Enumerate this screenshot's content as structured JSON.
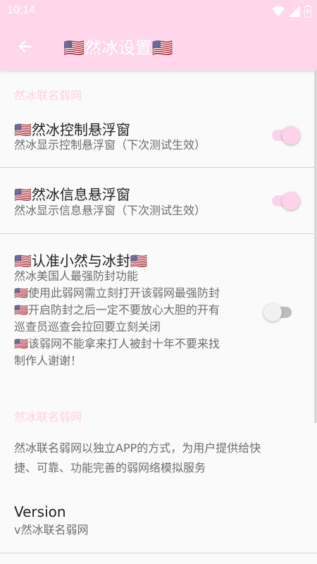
{
  "status_bar": {
    "time": "10:14",
    "icons": [
      "wifi-icon",
      "signal-icon",
      "battery-charging-icon"
    ]
  },
  "app_bar": {
    "title": "🇺🇸然冰设置🇺🇸",
    "back_icon": "arrow-left-icon"
  },
  "colors": {
    "accent": "#ffd6ec",
    "category_text": "#ffcfe6",
    "switch_on": "#fdd3ea"
  },
  "sections": {
    "header1": "然冰联名弱网",
    "pref1": {
      "title": "🇺🇸然冰控制悬浮窗",
      "summary": "然冰显示控制悬浮窗（下次测试生效）",
      "checked": true
    },
    "pref2": {
      "title": "🇺🇸然冰信息悬浮窗",
      "summary": "然冰显示信息悬浮窗（下次测试生效）",
      "checked": true
    },
    "pref3": {
      "title": "🇺🇸认准小然与冰封🇺🇸",
      "summary_lines": [
        "然冰美国人最强防封功能",
        "🇺🇸使用此弱网需立刻打开该弱网最强防封",
        "🇺🇸开启防封之后一定不要放心大胆的开有",
        "巡查员巡查会拉回要立刻关闭",
        "🇺🇸该弱网不能拿来打人被封十年不要来找",
        "制作人谢谢！"
      ],
      "checked": false
    },
    "header2": "然冰联名弱网",
    "about_lines": [
      "然冰联名弱网以独立APP的方式，为用户提供给快",
      "捷、可靠、功能完善的弱网络模拟服务"
    ],
    "version": {
      "title": "Version",
      "summary": "v然冰联名弱网"
    }
  }
}
